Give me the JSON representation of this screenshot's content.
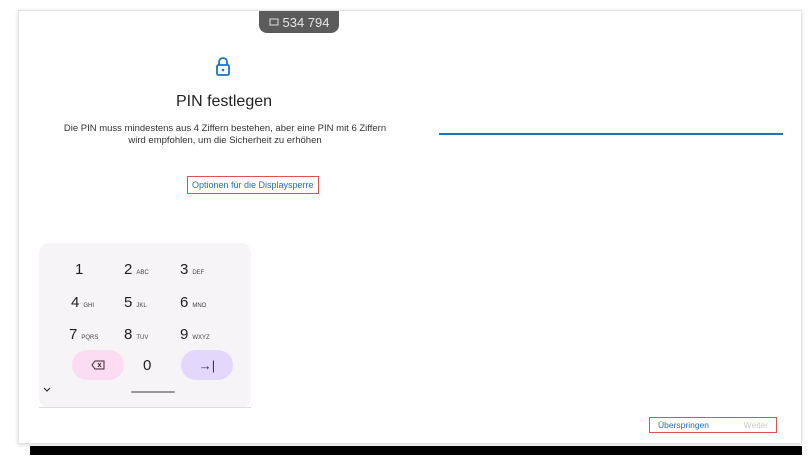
{
  "status_chip": {
    "text": "534 794"
  },
  "header": {
    "title": "PIN festlegen",
    "description_line1": "Die PIN muss mindestens aus 4 Ziffern bestehen, aber eine PIN mit 6 Ziffern",
    "description_line2": "wird empfohlen, um die Sicherheit zu erhöhen"
  },
  "options_link": "Optionen für die Displaysperre",
  "keypad": {
    "keys": [
      {
        "digit": "1",
        "letters": ""
      },
      {
        "digit": "2",
        "letters": "ABC"
      },
      {
        "digit": "3",
        "letters": "DEF"
      },
      {
        "digit": "4",
        "letters": "GHI"
      },
      {
        "digit": "5",
        "letters": "JKL"
      },
      {
        "digit": "6",
        "letters": "MNO"
      },
      {
        "digit": "7",
        "letters": "PQRS"
      },
      {
        "digit": "8",
        "letters": "TUV"
      },
      {
        "digit": "9",
        "letters": "WXYZ"
      },
      {
        "digit": "0",
        "letters": ""
      }
    ],
    "delete_icon": "backspace-icon",
    "enter_icon": "tab-arrow-icon",
    "enter_symbol": "→|"
  },
  "actions": {
    "skip_label": "Überspringen",
    "next_label": "Weiter"
  },
  "colors": {
    "accent": "#1a73c8",
    "delete_pill": "#fbdcf2",
    "enter_pill": "#e3d8fb",
    "highlight_box": "#e05050"
  }
}
